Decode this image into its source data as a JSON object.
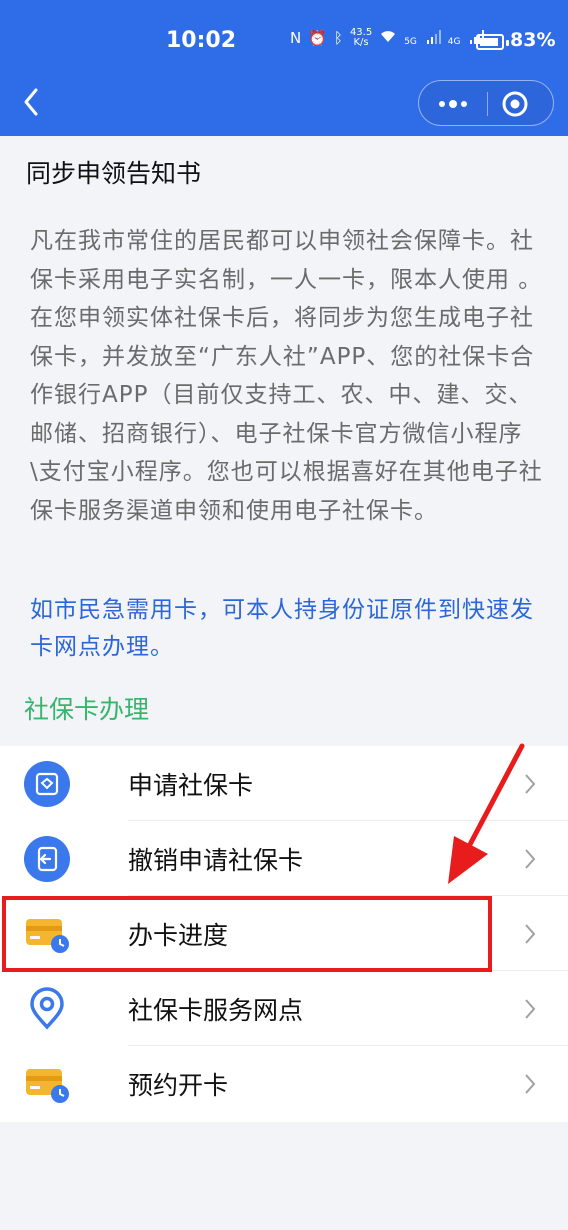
{
  "status_bar": {
    "time": "10:02",
    "net_speed": "43.5",
    "net_unit": "K/s",
    "sim1": "5G",
    "sim2": "4G",
    "battery": "83%"
  },
  "notice": {
    "title": "同步申领告知书",
    "body": "凡在我市常住的居民都可以申领社会保障卡。社保卡采用电子实名制，一人一卡，限本人使用 。在您申领实体社保卡后，将同步为您生成电子社保卡，并发放至“广东人社”APP、您的社保卡合作银行APP（目前仅支持工、农、中、建、交、邮储、招商银行）、电子社保卡官方微信小程序\\支付宝小程序。您也可以根据喜好在其他电子社保卡服务渠道申领和使用电子社保卡。",
    "tip": "如市民急需用卡，可本人持身份证原件到快速发卡网点办理。"
  },
  "section_title": "社保卡办理",
  "menu": [
    {
      "label": "申请社保卡",
      "icon": "apply-card-icon"
    },
    {
      "label": "撤销申请社保卡",
      "icon": "revoke-icon"
    },
    {
      "label": "办卡进度",
      "icon": "card-progress-icon"
    },
    {
      "label": "社保卡服务网点",
      "icon": "location-pin-icon"
    },
    {
      "label": "预约开卡",
      "icon": "appointment-card-icon"
    }
  ],
  "colors": {
    "header_bg": "#2f6de8",
    "section_title": "#38b46d",
    "tip_text": "#2b67d8",
    "highlight": "#e81c1c"
  }
}
